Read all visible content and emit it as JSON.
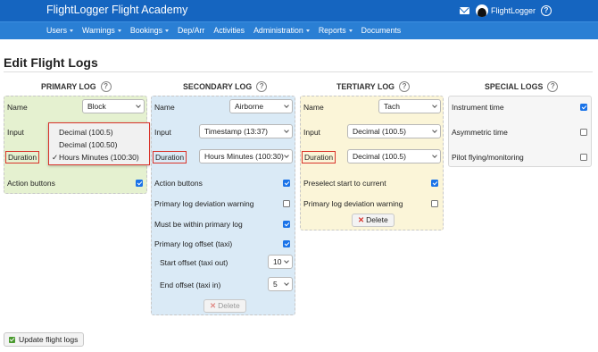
{
  "header": {
    "brand": "FlightLogger Flight Academy",
    "user_name": "FlightLogger",
    "help": "?"
  },
  "nav": [
    {
      "label": "Users",
      "dropdown": true
    },
    {
      "label": "Warnings",
      "dropdown": true
    },
    {
      "label": "Bookings",
      "dropdown": true
    },
    {
      "label": "Dep/Arr",
      "dropdown": false
    },
    {
      "label": "Activities",
      "dropdown": false
    },
    {
      "label": "Administration",
      "dropdown": true
    },
    {
      "label": "Reports",
      "dropdown": true
    },
    {
      "label": "Documents",
      "dropdown": false
    }
  ],
  "page": {
    "title": "Edit Flight Logs",
    "update_button": "Update flight logs"
  },
  "primary": {
    "title": "PRIMARY LOG",
    "name_label": "Name",
    "name_value": "Block",
    "input_label": "Input",
    "duration_label": "Duration",
    "action_buttons_label": "Action buttons",
    "action_buttons_checked": true,
    "dropdown_options": [
      "Decimal (100.5)",
      "Decimal (100.50)",
      "Hours Minutes (100:30)"
    ],
    "dropdown_selected": "Hours Minutes (100:30)",
    "check_mark": "✓"
  },
  "secondary": {
    "title": "SECONDARY LOG",
    "name_label": "Name",
    "name_value": "Airborne",
    "input_label": "Input",
    "input_value": "Timestamp (13:37)",
    "duration_label": "Duration",
    "duration_value": "Hours Minutes (100:30)",
    "rows": [
      {
        "label": "Action buttons",
        "checked": true
      },
      {
        "label": "Primary log deviation warning",
        "checked": false
      },
      {
        "label": "Must be within primary log",
        "checked": true
      },
      {
        "label": "Primary log offset (taxi)",
        "checked": true
      }
    ],
    "start_offset_label": "Start offset (taxi out)",
    "start_offset_value": "10",
    "end_offset_label": "End offset (taxi in)",
    "end_offset_value": "5",
    "delete_label": "Delete"
  },
  "tertiary": {
    "title": "TERTIARY LOG",
    "name_label": "Name",
    "name_value": "Tach",
    "input_label": "Input",
    "input_value": "Decimal (100.5)",
    "duration_label": "Duration",
    "duration_value": "Decimal (100.5)",
    "rows": [
      {
        "label": "Preselect start to current",
        "checked": true
      },
      {
        "label": "Primary log deviation warning",
        "checked": false
      }
    ],
    "delete_label": "Delete"
  },
  "special": {
    "title": "SPECIAL LOGS",
    "rows": [
      {
        "label": "Instrument time",
        "checked": true
      },
      {
        "label": "Asymmetric time",
        "checked": false
      },
      {
        "label": "Pilot flying/monitoring",
        "checked": false
      }
    ]
  },
  "colors": {
    "topbar": "#1565c0",
    "navbar": "#2a7fd4",
    "primary_panel": "#e5f1d0",
    "secondary_panel": "#daeaf6",
    "tertiary_panel": "#fbf5d8",
    "highlight": "#d9342b",
    "checkbox": "#1a73e8"
  }
}
